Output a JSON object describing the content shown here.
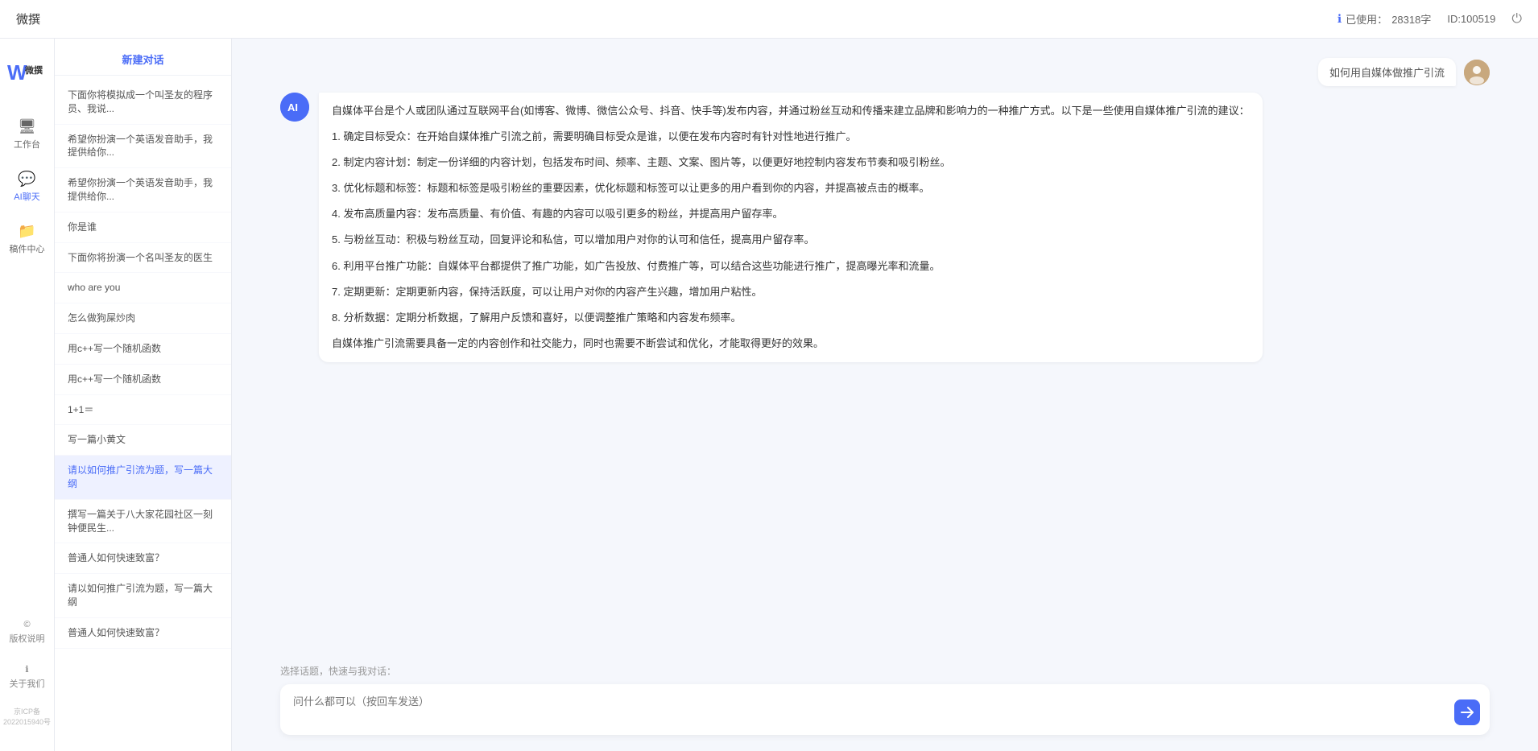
{
  "topbar": {
    "title": "微撰",
    "usage_label": "已使用：",
    "usage_value": "28318字",
    "id_label": "ID:100519",
    "logout_icon": "⏻"
  },
  "nav": {
    "logo_text": "W 微撰",
    "items": [
      {
        "id": "workbench",
        "icon": "🖥",
        "label": "工作台"
      },
      {
        "id": "ai-chat",
        "icon": "💬",
        "label": "AI聊天",
        "active": true
      },
      {
        "id": "draft",
        "icon": "📁",
        "label": "稿件中心"
      }
    ],
    "bottom_items": [
      {
        "id": "copyright",
        "icon": "©",
        "label": "版权说明"
      },
      {
        "id": "about",
        "icon": "ℹ",
        "label": "关于我们"
      }
    ],
    "icp": "京ICP备2022015940号"
  },
  "sidebar": {
    "new_chat": "新建对话",
    "items": [
      {
        "id": 1,
        "text": "下面你将模拟成一个叫圣友的程序员、我说..."
      },
      {
        "id": 2,
        "text": "希望你扮演一个英语发音助手，我提供给你..."
      },
      {
        "id": 3,
        "text": "希望你扮演一个英语发音助手，我提供给你..."
      },
      {
        "id": 4,
        "text": "你是谁"
      },
      {
        "id": 5,
        "text": "下面你将扮演一个名叫圣友的医生"
      },
      {
        "id": 6,
        "text": "who are you",
        "active": false
      },
      {
        "id": 7,
        "text": "怎么做狗屎炒肉"
      },
      {
        "id": 8,
        "text": "用c++写一个随机函数"
      },
      {
        "id": 9,
        "text": "用c++写一个随机函数"
      },
      {
        "id": 10,
        "text": "1+1＝"
      },
      {
        "id": 11,
        "text": "写一篇小黄文"
      },
      {
        "id": 12,
        "text": "请以如何推广引流为题，写一篇大纲",
        "active": true
      },
      {
        "id": 13,
        "text": "撰写一篇关于八大家花园社区一刻钟便民生..."
      },
      {
        "id": 14,
        "text": "普通人如何快速致富？"
      },
      {
        "id": 15,
        "text": "请以如何推广引流为题，写一篇大纲"
      },
      {
        "id": 16,
        "text": "普通人如何快速致富？"
      }
    ]
  },
  "chat": {
    "user_avatar_text": "用户",
    "ai_avatar_text": "AI",
    "question": "如何用自媒体做推广引流",
    "ai_response": {
      "intro": "自媒体平台是个人或团队通过互联网平台(如博客、微博、微信公众号、抖音、快手等)发布内容，并通过粉丝互动和传播来建立品牌和影响力的一种推广方式。以下是一些使用自媒体推广引流的建议：",
      "points": [
        "1. 确定目标受众：在开始自媒体推广引流之前，需要明确目标受众是谁，以便在发布内容时有针对性地进行推广。",
        "2. 制定内容计划：制定一份详细的内容计划，包括发布时间、频率、主题、文案、图片等，以便更好地控制内容发布节奏和吸引粉丝。",
        "3. 优化标题和标签：标题和标签是吸引粉丝的重要因素，优化标题和标签可以让更多的用户看到你的内容，并提高被点击的概率。",
        "4. 发布高质量内容：发布高质量、有价值、有趣的内容可以吸引更多的粉丝，并提高用户留存率。",
        "5. 与粉丝互动：积极与粉丝互动，回复评论和私信，可以增加用户对你的认可和信任，提高用户留存率。",
        "6. 利用平台推广功能：自媒体平台都提供了推广功能，如广告投放、付费推广等，可以结合这些功能进行推广，提高曝光率和流量。",
        "7. 定期更新：定期更新内容，保持活跃度，可以让用户对你的内容产生兴趣，增加用户粘性。",
        "8. 分析数据：定期分析数据，了解用户反馈和喜好，以便调整推广策略和内容发布频率。"
      ],
      "outro": "自媒体推广引流需要具备一定的内容创作和社交能力，同时也需要不断尝试和优化，才能取得更好的效果。"
    },
    "input_placeholder": "问什么都可以（按回车发送）",
    "quick_topics_label": "选择话题，快速与我对话："
  }
}
